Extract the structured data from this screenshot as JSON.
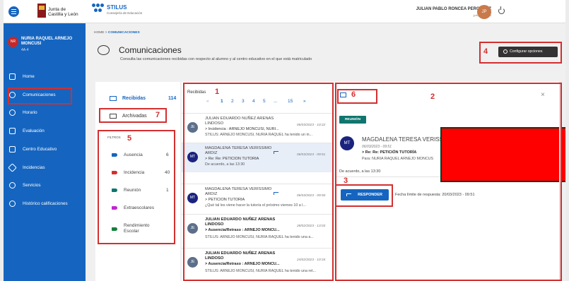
{
  "header": {
    "jcyl_line1": "Junta de",
    "jcyl_line2": "Castilla y León",
    "app_name": "STILUS",
    "app_subtitle": "Consejería de Educación",
    "user_name": "JULIAN PABLO RONCEA PEROSANZ",
    "user_id": "jprbgr@jcyl.es",
    "user_initials": "JP"
  },
  "sidebar": {
    "user_initials": "NR",
    "user_name": "NURIA RAQUEL ARNEJO MONCUSI",
    "user_group": "4A-4",
    "items": [
      {
        "label": "Home",
        "icon": "home-icon"
      },
      {
        "label": "Comunicaciones",
        "icon": "chat-icon"
      },
      {
        "label": "Horario",
        "icon": "clock-icon"
      },
      {
        "label": "Evaluación",
        "icon": "grade-icon"
      },
      {
        "label": "Centro Educativo",
        "icon": "school-icon"
      },
      {
        "label": "Incidencias",
        "icon": "incident-icon"
      },
      {
        "label": "Servicios",
        "icon": "services-icon"
      },
      {
        "label": "Histórico calificaciones",
        "icon": "history-icon"
      }
    ]
  },
  "main": {
    "breadcrumb_home": "HOME",
    "breadcrumb_sep": ">",
    "breadcrumb_current": "COMUNICACIONES",
    "title": "Comunicaciones",
    "description": "Consulta las comunicaciones recibidas con respecto al alumno y al centro educativo en el que está matriculado",
    "config_button": "Configurar opciones"
  },
  "folders": [
    {
      "label": "Recibidas",
      "count": "114"
    },
    {
      "label": "Archivadas",
      "count": ""
    }
  ],
  "filters_label": "FILTROS",
  "filters": [
    {
      "label": "Ausencia",
      "count": "6",
      "color": "#1565c0"
    },
    {
      "label": "Incidencia",
      "count": "40",
      "color": "#d32f2f"
    },
    {
      "label": "Reunión",
      "count": "1",
      "color": "#0f766e"
    },
    {
      "label": "Extraescolares",
      "count": "",
      "color": "#c026d3"
    },
    {
      "label": "Rendimiento Escolar",
      "count": "",
      "color": "#15803d"
    }
  ],
  "list": {
    "heading": "Recibidas",
    "pager": [
      "«",
      "1",
      "2",
      "3",
      "4",
      "5",
      "...",
      "15",
      "»"
    ],
    "messages": [
      {
        "initials": "JE",
        "from": "JULIAN EDUARDO NUÑEZ ARENAS LINDOSO",
        "date": "06/03/2023 - 10:22",
        "subject": "> Incidencia : ARNEJO MONCUSI, NURI...",
        "preview": "STILUS: ARNEJO MONCUSI, NURIA RAQUEL ha tenido un in..."
      },
      {
        "initials": "MT",
        "from": "MAGDALENA TERESA VERISSIMO ARDIZ",
        "date": "06/03/2023 - 09:51",
        "subject": "> Re: Re: PETICIÓN TUTORÍA",
        "preview": "De acuerdo, a las 13:30"
      },
      {
        "initials": "MT",
        "from": "MAGDALENA TERESA VERISSIMO ARDIZ",
        "date": "06/03/2023 - 09:50",
        "subject": "> PETICIÓN TUTORÍA",
        "preview": "¿Qué tal les viene hacer la tutoría el próximo viernes 10 a l..."
      },
      {
        "initials": "JE",
        "from": "JULIAN EDUARDO NUÑEZ ARENAS LINDOSO",
        "date": "28/02/2023 - 13:03",
        "subject": "> Ausencia/Retraso : ARNEJO MONCU...",
        "preview": "STILUS: ARNEJO MONCUSI, NURIA RAQUEL ha tenido una a..."
      },
      {
        "initials": "JE",
        "from": "JULIAN EDUARDO NUÑEZ ARENAS LINDOSO",
        "date": "24/02/2023 - 10:34",
        "subject": "> Ausencia/Retraso : ARNEJO MONCU...",
        "preview": "STILUS: ARNEJO MONCUSI, NURIA RAQUEL ha tenido una ret..."
      }
    ]
  },
  "detail": {
    "badge": "REUNIÓN",
    "initials": "MT",
    "from": "MAGDALENA TERESA VERISSIMO",
    "date": "06/03/2023 - 09:51",
    "subject": "> Re: Re: PETICIÓN TUTORÍA",
    "to": "Para: NURIA RAQUEL ARNEJO MONCUS",
    "body": "De acuerdo, a las 13:30",
    "reply_button": "RESPONDER",
    "deadline": "Fecha límite de respuesta: 20/03/2023 - 09:51",
    "close": "×"
  },
  "annotations": [
    "1",
    "2",
    "3",
    "4",
    "5",
    "6",
    "7"
  ],
  "colors": {
    "accent": "#1565c0",
    "highlight": "#d32f2f"
  }
}
